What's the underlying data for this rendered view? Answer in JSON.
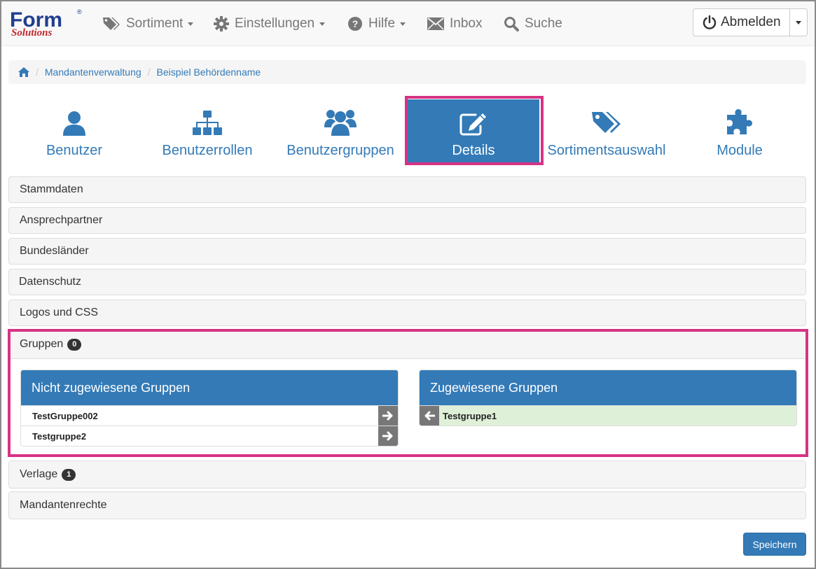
{
  "brand": {
    "logo_word": "Form",
    "logo_sub": "Solutions",
    "logo_mark": "®"
  },
  "nav": {
    "items": [
      {
        "label": "Sortiment",
        "icon": "tags-icon",
        "dropdown": true
      },
      {
        "label": "Einstellungen",
        "icon": "gear-icon",
        "dropdown": true
      },
      {
        "label": "Hilfe",
        "icon": "question-circle-icon",
        "dropdown": true
      },
      {
        "label": "Inbox",
        "icon": "envelope-icon",
        "dropdown": false
      },
      {
        "label": "Suche",
        "icon": "search-icon",
        "dropdown": false
      }
    ],
    "logout_label": "Abmelden"
  },
  "breadcrumb": {
    "items": [
      "Mandantenverwaltung",
      "Beispiel Behördenname"
    ]
  },
  "tiles": [
    {
      "label": "Benutzer",
      "icon": "user-icon"
    },
    {
      "label": "Benutzerrollen",
      "icon": "sitemap-icon"
    },
    {
      "label": "Benutzergruppen",
      "icon": "users-icon"
    },
    {
      "label": "Details",
      "icon": "edit-icon",
      "active": true
    },
    {
      "label": "Sortimentsauswahl",
      "icon": "tags-icon"
    },
    {
      "label": "Module",
      "icon": "puzzle-icon"
    }
  ],
  "panels": {
    "stammdaten": "Stammdaten",
    "ansprechpartner": "Ansprechpartner",
    "bundeslaender": "Bundesländer",
    "datenschutz": "Datenschutz",
    "logos": "Logos und CSS",
    "gruppen": "Gruppen",
    "gruppen_badge": "0",
    "verlage": "Verlage",
    "verlage_badge": "1",
    "mandantenrechte": "Mandantenrechte"
  },
  "groups": {
    "unassigned_title": "Nicht zugewiesene Gruppen",
    "unassigned": [
      "TestGruppe002",
      "Testgruppe2"
    ],
    "assigned_title": "Zugewiesene Gruppen",
    "assigned": [
      "Testgruppe1"
    ]
  },
  "save_label": "Speichern",
  "colors": {
    "primary": "#337ab7",
    "highlight": "#d63384",
    "assigned_row": "#dff0d8"
  }
}
